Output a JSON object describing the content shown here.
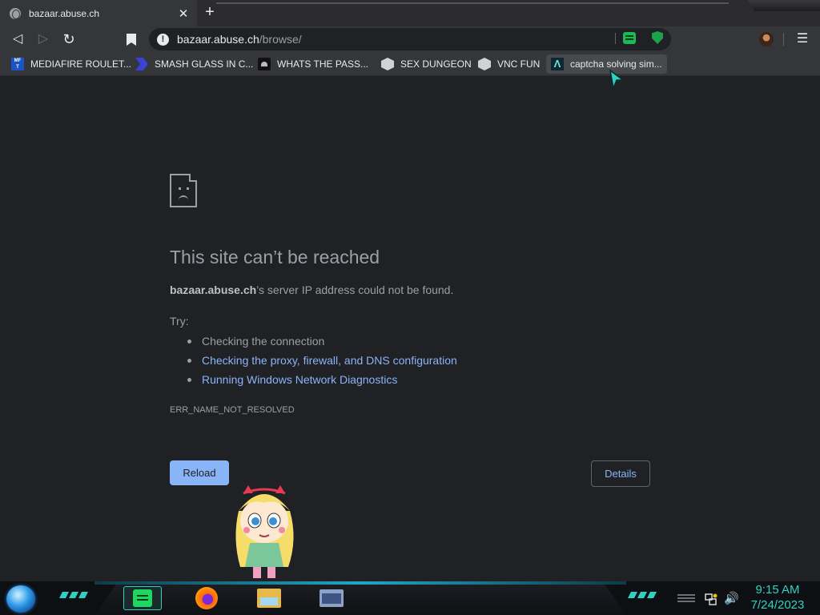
{
  "tab": {
    "title": "bazaar.abuse.ch",
    "close_glyph": "✕",
    "favicon": "globe-icon"
  },
  "new_tab_glyph": "+",
  "toolbar": {
    "back_glyph": "◁",
    "forward_glyph": "▷",
    "reload_glyph": "↻",
    "bookmark_glyph": "🔖",
    "menu_glyph": "☰"
  },
  "omnibox": {
    "info_glyph": "!",
    "host": "bazaar.abuse.ch",
    "path": "/browse/"
  },
  "bookmarks": [
    {
      "label": "MEDIAFIRE ROULET...",
      "icon": "mediafire-icon",
      "icon_text": "MF\nT"
    },
    {
      "label": "SMASH GLASS IN C...",
      "icon": "smash-icon"
    },
    {
      "label": "WHATS THE PASS...",
      "icon": "github-icon"
    },
    {
      "label": "SEX DUNGEON",
      "icon": "hexagon-icon"
    },
    {
      "label": "VNC FUN",
      "icon": "hexagon-icon"
    },
    {
      "label": "captcha solving sim...",
      "icon": "captcha-icon",
      "icon_text": "Λ"
    }
  ],
  "error_page": {
    "title": "This site can’t be reached",
    "host": "bazaar.abuse.ch",
    "description_suffix": "’s server IP address could not be found.",
    "try_label": "Try:",
    "suggestions": [
      {
        "text": "Checking the connection",
        "link": false
      },
      {
        "text": "Checking the proxy, firewall, and DNS configuration",
        "link": true
      },
      {
        "text": "Running Windows Network Diagnostics",
        "link": true
      }
    ],
    "error_code": "ERR_NAME_NOT_RESOLVED",
    "reload_label": "Reload",
    "details_label": "Details"
  },
  "taskbar": {
    "apps": [
      "spotify-icon",
      "firefox-icon",
      "file-explorer-icon",
      "window-icon"
    ],
    "volume_glyph": "🔊",
    "clock_time": "9:15 AM",
    "clock_date": "7/24/2023"
  },
  "colors": {
    "accent_link": "#8ab4f8",
    "clock": "#2fd3c4",
    "background": "#202124"
  }
}
